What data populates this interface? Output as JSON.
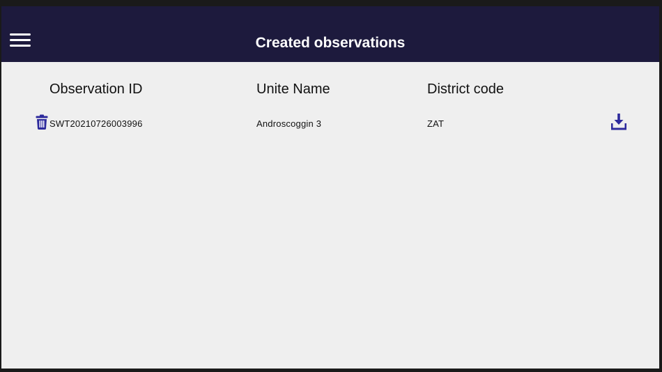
{
  "header": {
    "title": "Created observations",
    "menu_icon": "hamburger-menu-icon",
    "color": "#1d1a3d"
  },
  "table": {
    "columns": [
      "Observation ID",
      "Unite Name",
      "District code"
    ],
    "rows": [
      {
        "observation_id": "SWT20210726003996",
        "unite_name": "Androscoggin 3",
        "district_code": "ZAT",
        "delete_icon": "trash-icon",
        "download_icon": "download-icon"
      }
    ]
  },
  "colors": {
    "accent": "#2d2a9c",
    "background": "#efefef"
  }
}
